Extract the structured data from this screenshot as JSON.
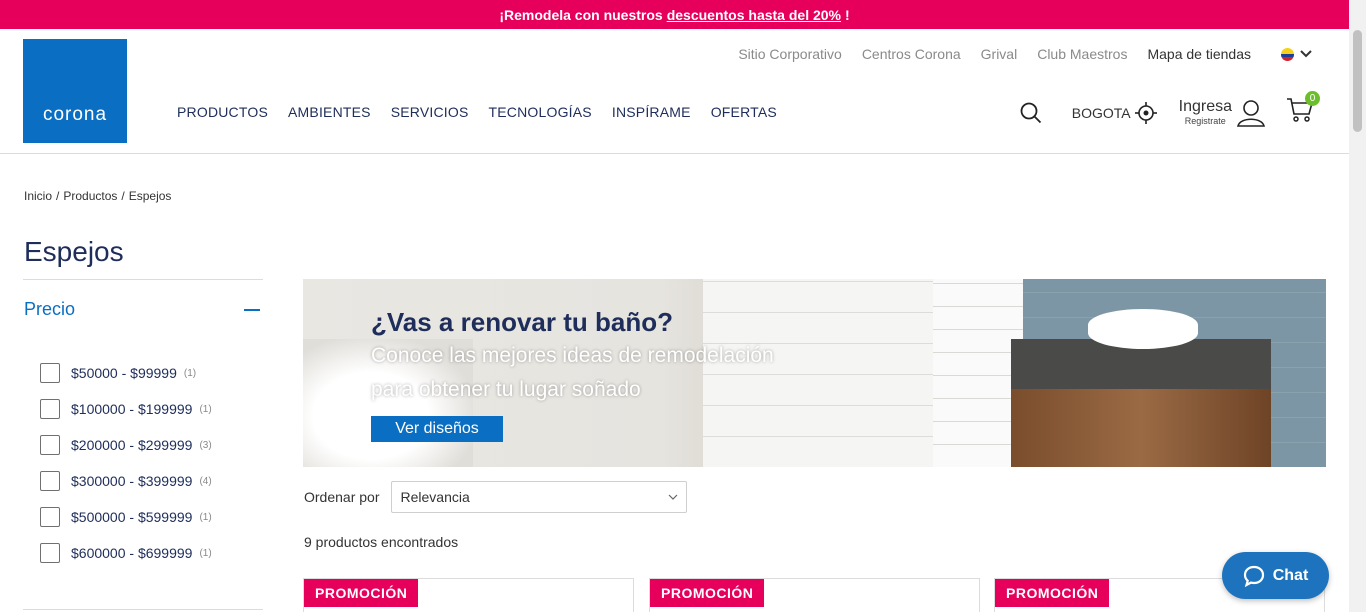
{
  "promo": {
    "text": "¡Remodela con nuestros",
    "link": "descuentos hasta del 20%",
    "end": "!"
  },
  "brand": {
    "logo_text": "corona",
    "color": "#0a6fc2",
    "accent": "#e6005c"
  },
  "top_links": [
    "Sitio Corporativo",
    "Centros Corona",
    "Grival",
    "Club Maestros",
    "Mapa de tiendas"
  ],
  "nav": [
    "PRODUCTOS",
    "AMBIENTES",
    "SERVICIOS",
    "TECNOLOGÍAS",
    "INSPÍRAME",
    "OFERTAS"
  ],
  "header": {
    "city": "BOGOTA",
    "login": "Ingresa",
    "register": "Registrate",
    "cart_count": "0"
  },
  "breadcrumb": [
    "Inicio",
    "/",
    "Productos",
    "/",
    "Espejos"
  ],
  "page": {
    "title": "Espejos"
  },
  "filter": {
    "title": "Precio",
    "items": [
      {
        "label": "$50000 - $99999",
        "count": "(1)"
      },
      {
        "label": "$100000 - $199999",
        "count": "(1)"
      },
      {
        "label": "$200000 - $299999",
        "count": "(3)"
      },
      {
        "label": "$300000 - $399999",
        "count": "(4)"
      },
      {
        "label": "$500000 - $599999",
        "count": "(1)"
      },
      {
        "label": "$600000 - $699999",
        "count": "(1)"
      }
    ]
  },
  "banner": {
    "title": "¿Vas a renovar tu baño?",
    "line1": "Conoce las mejores ideas de remodelación",
    "line2": "para obtener tu lugar soñado",
    "cta": "Ver diseños"
  },
  "sort": {
    "label": "Ordenar por",
    "selected": "Relevancia"
  },
  "results": {
    "text": "9 productos encontrados"
  },
  "cards": [
    {
      "badge": "PROMOCIÓN"
    },
    {
      "badge": "PROMOCIÓN"
    },
    {
      "badge": "PROMOCIÓN"
    }
  ],
  "chat": {
    "label": "Chat"
  },
  "icons": [
    "search-icon",
    "location-icon",
    "user-icon",
    "cart-icon",
    "chevron-down-icon",
    "chat-icon",
    "flag-icon"
  ]
}
